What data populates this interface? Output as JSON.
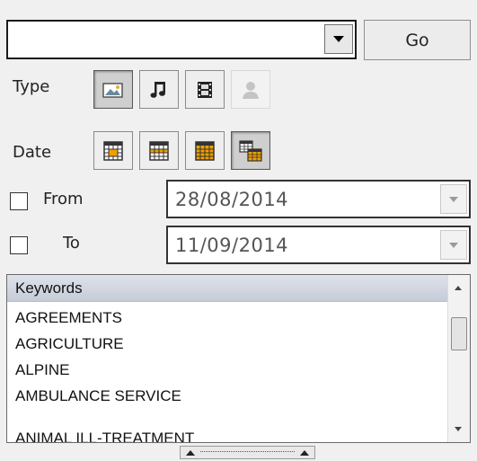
{
  "search": {
    "value": "",
    "go_label": "Go"
  },
  "type_filter": {
    "label": "Type",
    "buttons": [
      {
        "icon": "photo-icon",
        "pressed": true
      },
      {
        "icon": "music-note-icon",
        "pressed": false
      },
      {
        "icon": "film-icon",
        "pressed": false
      },
      {
        "icon": "person-icon",
        "disabled": true
      }
    ]
  },
  "date_filter": {
    "label": "Date",
    "buttons": [
      {
        "icon": "calendar-day-icon",
        "pressed": false
      },
      {
        "icon": "calendar-week-icon",
        "pressed": false
      },
      {
        "icon": "calendar-month-icon",
        "pressed": false
      },
      {
        "icon": "calendar-range-icon",
        "pressed": true
      }
    ]
  },
  "date_range": {
    "from": {
      "label": "From",
      "value": "28/08/2014",
      "checked": false
    },
    "to": {
      "label": "To",
      "value": "11/09/2014",
      "checked": false
    }
  },
  "keywords": {
    "header": "Keywords",
    "items": [
      "AGREEMENTS",
      "AGRICULTURE",
      "ALPINE",
      "AMBULANCE SERVICE",
      "ANIMAL ILL-TREATMENT"
    ]
  },
  "colors": {
    "accent_orange": "#f0a000",
    "border_dark": "#1a1a1a",
    "header_bg": "#cdd3dc"
  }
}
